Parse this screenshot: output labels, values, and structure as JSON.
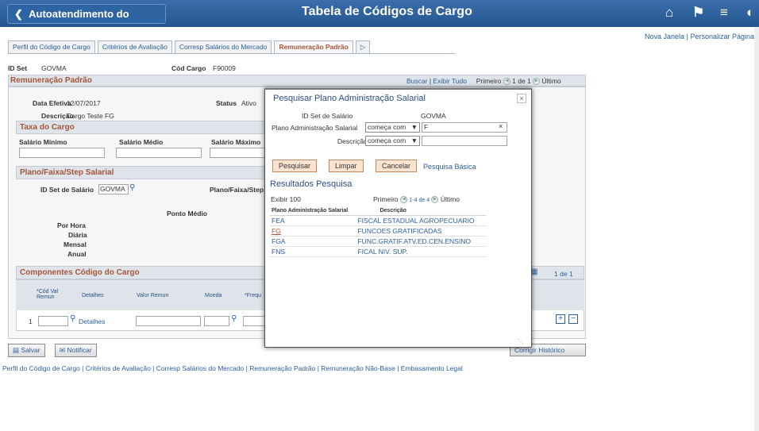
{
  "header": {
    "back_label": "Autoatendimento do Gerente",
    "title": "Tabela de Códigos de Cargo"
  },
  "toplinks": {
    "new_window": "Nova Janela",
    "separator": "|",
    "personalize": "Personalizar Página"
  },
  "tabs": [
    {
      "label": "Perfil do Código de Cargo"
    },
    {
      "label": "Critérios de Avaliação"
    },
    {
      "label": "Corresp Salários do Mercado"
    },
    {
      "label": "Remuneração Padrão"
    }
  ],
  "form": {
    "setid_label": "ID Set",
    "setid_value": "GOVMA",
    "code_label": "Cód Cargo",
    "code_value": "F90009",
    "section_title": "Remuneração Padrão",
    "nav": {
      "find": "Buscar",
      "view_all": "Exibir Tudo",
      "first": "Primeiro",
      "count": "1 de 1",
      "last": "Último"
    },
    "eff_date_label": "Data Efetiva",
    "eff_date_value": "12/07/2017",
    "status_label": "Status",
    "status_value": "Ativo",
    "desc_label": "Descrição",
    "desc_value": "Cargo Teste FG",
    "rate_section": "Taxa do Cargo",
    "min_label": "Salário Mínimo",
    "mid_label": "Salário Médio",
    "max_label": "Salário Máximo",
    "plan_section": "Plano/Faixa/Step Salarial",
    "setid_sal_label": "ID Set de Salário",
    "setid_sal_value": "GOVMA",
    "plan_label": "Plano/Faixa/Step",
    "midpoint_label": "Ponto Médio",
    "hourly": "Por Hora",
    "daily": "Diária",
    "monthly": "Mensal",
    "annual": "Anual",
    "comp_section": "Componentes Código do Cargo",
    "comp_count": "1 de 1",
    "comp_cols": {
      "code": "*Cód Val Remun",
      "details": "Detalhes",
      "value": "Valor Remun",
      "currency": "Moeda",
      "freq": "*Frequ"
    },
    "comp_row_num": "1",
    "comp_details_link": "Detalhes"
  },
  "bottom": {
    "save": "Salvar",
    "notify": "Notificar",
    "correct_history": "Corrigir Histórico",
    "links": "Perfil do Código de Cargo | Critérios de Avaliação | Corresp Salários do Mercado | Remuneração Padrão | Remuneração Não-Base | Embasamento Legal"
  },
  "modal": {
    "title": "Pesquisar Plano Administração Salarial",
    "close": "×",
    "setid_label": "ID Set de Salário",
    "setid_value": "GOVMA",
    "plan_label": "Plano Administração Salarial",
    "plan_op": "começa com",
    "plan_value": "F",
    "desc_label": "Descrição",
    "desc_op": "começa com",
    "desc_value": "",
    "btn_search": "Pesquisar",
    "btn_clear": "Limpar",
    "btn_cancel": "Cancelar",
    "basic_search": "Pesquisa Básica",
    "results_title": "Resultados Pesquisa",
    "show_100": "Exibir 100",
    "first": "Primeiro",
    "range": "1-4 de 4",
    "last": "Último",
    "col_plan": "Plano Administração Salarial",
    "col_desc": "Descrição",
    "rows": [
      {
        "plan": "FEA",
        "desc": "FISCAL ESTADUAL AGROPECUARIO"
      },
      {
        "plan": "FG",
        "desc": "FUNCOES GRATIFICADAS"
      },
      {
        "plan": "FGA",
        "desc": "FUNC.GRATIF.ATV.ED.CEN.ENSINO"
      },
      {
        "plan": "FNS",
        "desc": "FICAL NIV. SUP."
      }
    ]
  }
}
